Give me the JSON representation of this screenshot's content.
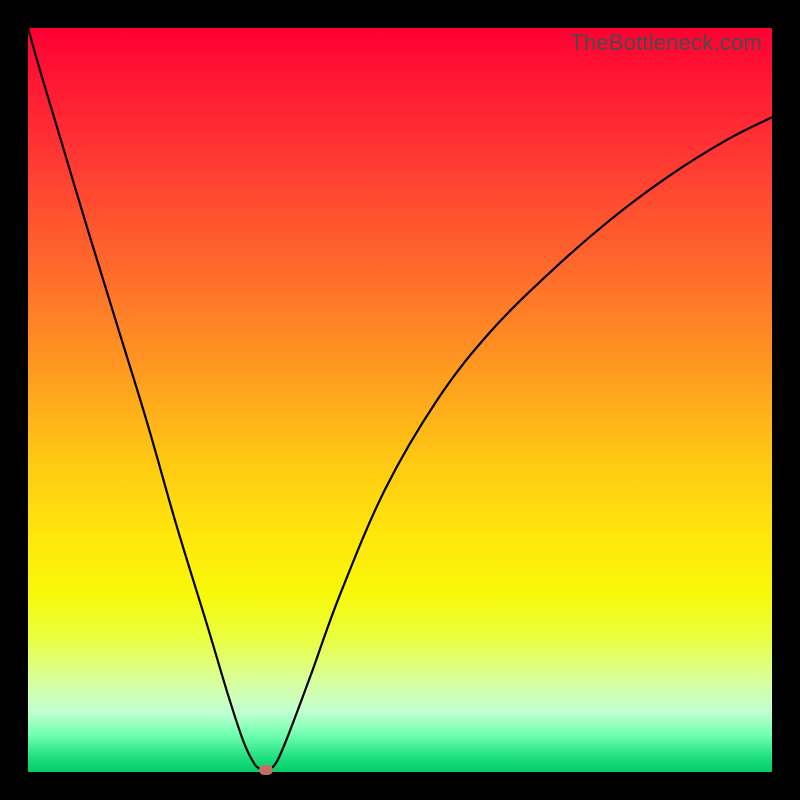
{
  "watermark": "TheBottleneck.com",
  "colors": {
    "frame": "#000000",
    "gradient_top": "#ff0033",
    "gradient_bottom": "#00cc66",
    "curve": "#000000",
    "marker": "#c46e66"
  },
  "chart_data": {
    "type": "line",
    "title": "",
    "xlabel": "",
    "ylabel": "",
    "xlim": [
      0,
      100
    ],
    "ylim": [
      0,
      100
    ],
    "grid": false,
    "legend": false,
    "series": [
      {
        "name": "bottleneck-curve",
        "x": [
          0,
          2,
          5,
          8,
          12,
          16,
          20,
          24,
          27,
          29,
          30.5,
          31.5,
          32,
          32.5,
          33.5,
          35,
          38,
          42,
          48,
          55,
          62,
          70,
          78,
          86,
          94,
          100
        ],
        "y": [
          100,
          93,
          83,
          73,
          60,
          47,
          33,
          20,
          10,
          4,
          1,
          0.3,
          0,
          0.3,
          1.5,
          5,
          13,
          24,
          38,
          50,
          59,
          67,
          74,
          80,
          85,
          88
        ]
      }
    ],
    "marker": {
      "x": 32,
      "y": 0
    }
  }
}
